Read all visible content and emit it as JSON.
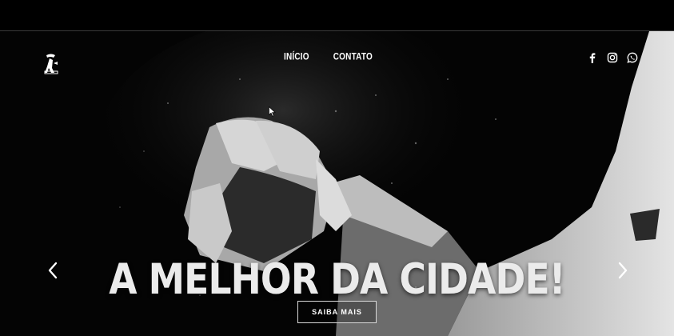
{
  "nav": {
    "items": [
      {
        "label": "INÍCIO"
      },
      {
        "label": "CONTATO"
      }
    ]
  },
  "social": {
    "icons": [
      "facebook-icon",
      "instagram-icon",
      "whatsapp-icon"
    ]
  },
  "hero": {
    "headline": "A MELHOR DA CIDADE!",
    "cta_label": "SAIBA MAIS"
  },
  "colors": {
    "background": "#000000",
    "text": "#ffffff",
    "headline": "#ebebeb"
  }
}
